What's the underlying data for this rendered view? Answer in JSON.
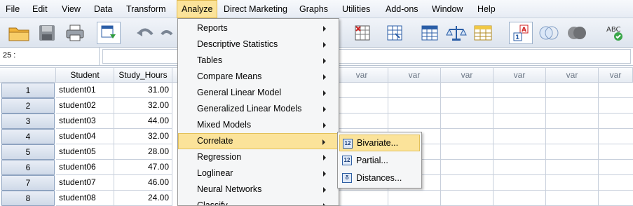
{
  "menubar": {
    "items": [
      "File",
      "Edit",
      "View",
      "Data",
      "Transform",
      "Analyze",
      "Direct Marketing",
      "Graphs",
      "Utilities",
      "Add-ons",
      "Window",
      "Help"
    ],
    "active": "Analyze"
  },
  "toolbar": {
    "icons": [
      "open-folder-icon",
      "save-icon",
      "print-icon",
      "dialog-recall-icon",
      "undo-icon",
      "redo-icon",
      "insert-cases-icon",
      "insert-variable-icon",
      "split-file-icon",
      "weight-cases-icon",
      "select-cases-icon",
      "value-labels-icon",
      "use-sets-icon",
      "show-all-variables-icon",
      "spell-check-icon"
    ]
  },
  "cell_editor": {
    "reference": "25 :",
    "value": ""
  },
  "grid": {
    "columns": [
      "Student",
      "Study_Hours",
      "var",
      "var",
      "var",
      "var",
      "var",
      "var",
      "var",
      "var"
    ],
    "rows": [
      {
        "num": "1",
        "student": "student01",
        "hours": "31.00"
      },
      {
        "num": "2",
        "student": "student02",
        "hours": "32.00"
      },
      {
        "num": "3",
        "student": "student03",
        "hours": "44.00"
      },
      {
        "num": "4",
        "student": "student04",
        "hours": "32.00"
      },
      {
        "num": "5",
        "student": "student05",
        "hours": "28.00"
      },
      {
        "num": "6",
        "student": "student06",
        "hours": "47.00"
      },
      {
        "num": "7",
        "student": "student07",
        "hours": "46.00"
      },
      {
        "num": "8",
        "student": "student08",
        "hours": "24.00"
      }
    ]
  },
  "analyze_menu": {
    "items": [
      "Reports",
      "Descriptive Statistics",
      "Tables",
      "Compare Means",
      "General Linear Model",
      "Generalized Linear Models",
      "Mixed Models",
      "Correlate",
      "Regression",
      "Loglinear",
      "Neural Networks",
      "Classify"
    ],
    "highlighted": "Correlate"
  },
  "correlate_submenu": {
    "items": [
      "Bivariate...",
      "Partial...",
      "Distances..."
    ],
    "highlighted": "Bivariate..."
  },
  "colors": {
    "highlight": "#fbe39a",
    "menu_bg": "#f5f6f7",
    "row_header": "#cfd9e8"
  }
}
